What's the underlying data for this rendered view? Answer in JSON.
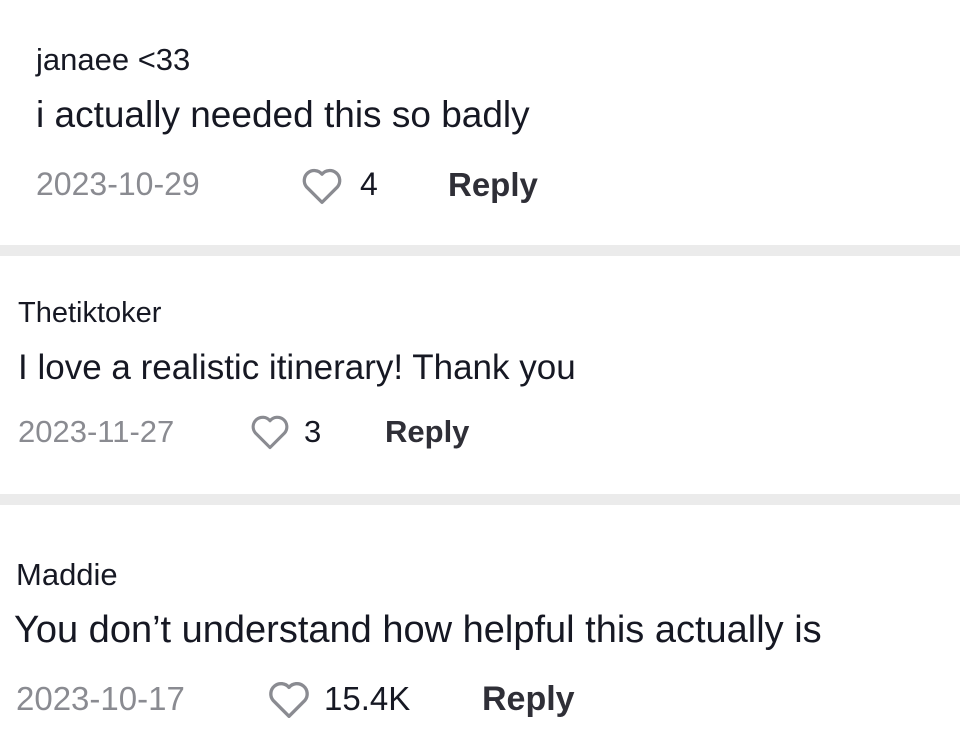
{
  "comments": [
    {
      "username": "janaee <33",
      "text": "i actually needed this so badly",
      "date": "2023-10-29",
      "likes": "4",
      "reply_label": "Reply"
    },
    {
      "username": "Thetiktoker",
      "text": "I love a realistic itinerary! Thank you",
      "date": "2023-11-27",
      "likes": "3",
      "reply_label": "Reply"
    },
    {
      "username": "Maddie",
      "text": "You don’t understand how helpful this actually is",
      "date": "2023-10-17",
      "likes": "15.4K",
      "reply_label": "Reply"
    }
  ],
  "icons": {
    "like": "heart-outline-icon"
  }
}
